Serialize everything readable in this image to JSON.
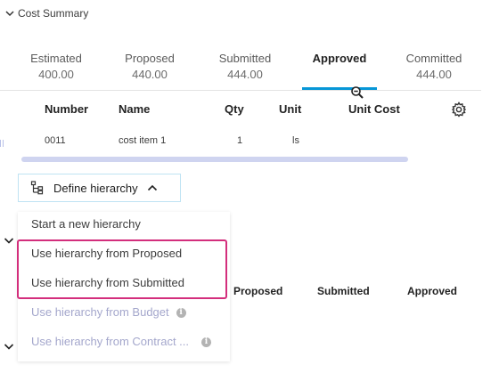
{
  "section": {
    "title": "Cost Summary"
  },
  "tabs": [
    {
      "label": "Estimated",
      "value": "400.00"
    },
    {
      "label": "Proposed",
      "value": "440.00"
    },
    {
      "label": "Submitted",
      "value": "444.00"
    },
    {
      "label": "Approved",
      "value": ""
    },
    {
      "label": "Committed",
      "value": "444.00"
    }
  ],
  "active_tab": "Approved",
  "table": {
    "headers": [
      "Number",
      "Name",
      "Qty",
      "Unit",
      "Unit Cost"
    ],
    "rows": [
      [
        "0011",
        "cost item 1",
        "1",
        "ls",
        ""
      ]
    ]
  },
  "define_hierarchy": {
    "label": "Define hierarchy"
  },
  "menu": {
    "items": [
      {
        "label": "Start a new hierarchy",
        "enabled": true,
        "info": false
      },
      {
        "label": "Use hierarchy from Proposed",
        "enabled": true,
        "info": false
      },
      {
        "label": "Use hierarchy from Submitted",
        "enabled": true,
        "info": false
      },
      {
        "label": "Use hierarchy from Budget",
        "enabled": false,
        "info": true
      },
      {
        "label": "Use hierarchy from Contract ...",
        "enabled": false,
        "info": true
      }
    ]
  },
  "bottom_headers": [
    "Proposed",
    "Submitted",
    "Approved"
  ],
  "colors": {
    "accent": "#0696d7",
    "highlight": "#d32e7c",
    "disabled_text": "#a4a7cc",
    "scrollbar": "#cfd4f0"
  },
  "icons": [
    "chevron-down-icon",
    "zoom-out-icon",
    "gear-icon",
    "hierarchy-icon",
    "chevron-up-icon",
    "info-icon"
  ]
}
